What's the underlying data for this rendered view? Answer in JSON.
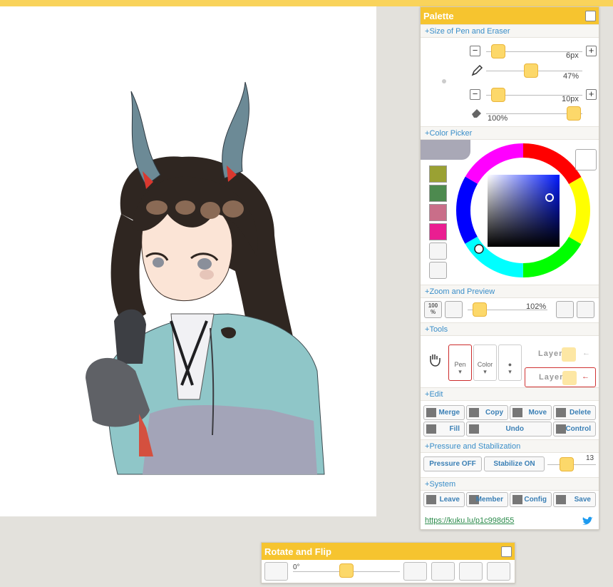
{
  "palette": {
    "title": "Palette",
    "sections": {
      "size": "Size of Pen and Eraser",
      "color": "Color Picker",
      "zoom": "Zoom and Preview",
      "tools": "Tools",
      "edit": "Edit",
      "pressure": "Pressure and Stabilization",
      "system": "System"
    },
    "pen_size": "6px",
    "pen_opacity": "47%",
    "eraser_size": "10px",
    "eraser_opacity": "100%",
    "swatches": [
      "#9aa133",
      "#4d8a4f",
      "#c96e89",
      "#ea1e91"
    ],
    "picker_color": "#1f2fd6",
    "zoom_label": "100\n%",
    "zoom_value": "102%",
    "tools": {
      "pen": "Pen",
      "color": "Color",
      "layer1": "Layer1",
      "layer2": "Layer2"
    },
    "edit": {
      "merge": "Merge",
      "copy": "Copy",
      "move": "Move",
      "delete": "Delete",
      "fill": "Fill",
      "undo": "Undo",
      "control": "Control"
    },
    "pressure": {
      "pressure_btn": "Pressure OFF",
      "stabilize_btn": "Stabilize ON",
      "stabilize_value": "13"
    },
    "system": {
      "leave": "Leave",
      "member": "Member",
      "config": "Config",
      "save": "Save"
    },
    "link": "https://kuku.lu/p1c998d55"
  },
  "rotate": {
    "title": "Rotate and Flip",
    "angle": "0°"
  }
}
